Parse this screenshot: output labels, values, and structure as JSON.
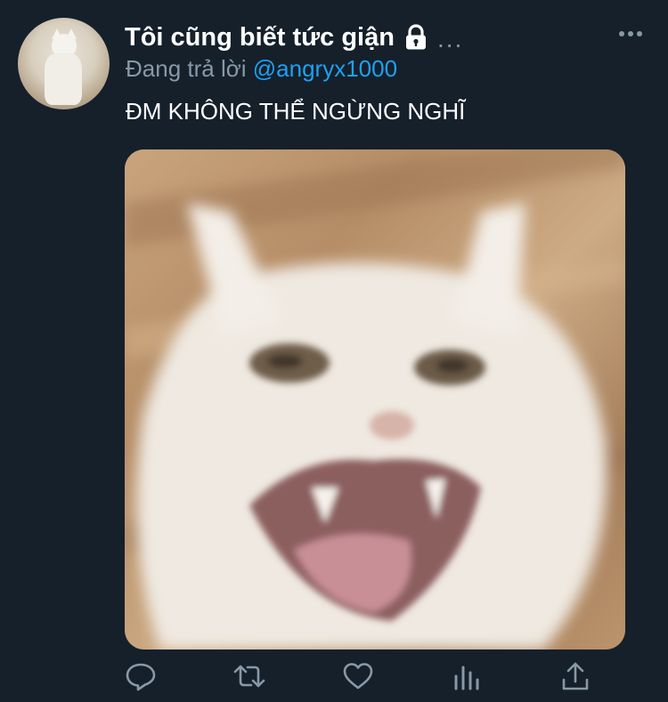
{
  "tweet": {
    "display_name": "Tôi cũng biết tức giận",
    "name_overflow": "...",
    "reply_prefix": "Đang trả lời ",
    "reply_handle": "@angryx1000",
    "text": "ĐM KHÔNG THỂ NGỪNG NGHĨ",
    "icons": {
      "lock": "lock-icon",
      "more": "more-icon",
      "reply": "reply-icon",
      "retweet": "retweet-icon",
      "like": "heart-icon",
      "analytics": "analytics-icon",
      "share": "share-icon"
    }
  },
  "colors": {
    "background": "#15202b",
    "text": "#ffffff",
    "secondary": "#8899a6",
    "link": "#1da1f2"
  }
}
